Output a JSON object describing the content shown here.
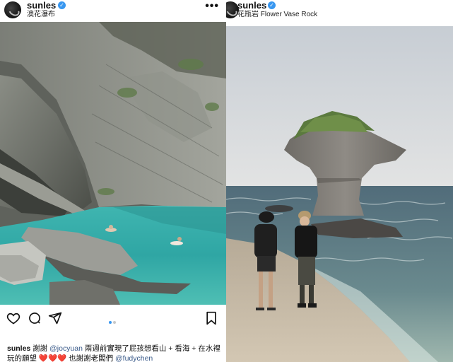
{
  "left_post": {
    "username": "sunles",
    "location": "澳花瀑布",
    "more_label": "•••",
    "carousel": {
      "count": 2,
      "active": 1
    },
    "caption": {
      "user": "sunles",
      "text1": " 謝謝 ",
      "mention1": "@jocyuan",
      "text2": " 兩週前實現了屁孩想看山 + 看海 + 在水裡玩的願望 ",
      "hearts": "❤️❤️❤️",
      "text3": " 也謝謝老闆們 ",
      "mention2": "@fudychen"
    },
    "icons": [
      "heart-icon",
      "comment-icon",
      "share-icon",
      "bookmark-icon"
    ]
  },
  "right_post": {
    "username": "sunles",
    "location": "花瓶岩 Flower Vase Rock"
  },
  "colors": {
    "verified": "#3897f0",
    "mention": "#3b5b8a",
    "active_dot": "#3897f0"
  }
}
